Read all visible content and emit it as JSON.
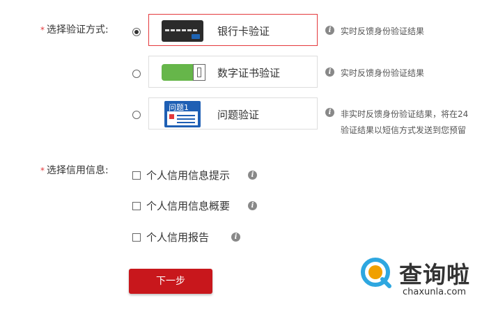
{
  "verify": {
    "label": "选择验证方式:",
    "required_mark": "*",
    "methods": [
      {
        "name": "银行卡验证",
        "icon": "bank-card-icon",
        "selected": true,
        "hint": [
          "实时反馈身份验证结果"
        ]
      },
      {
        "name": "数字证书验证",
        "icon": "usb-key-icon",
        "selected": false,
        "hint": [
          "实时反馈身份验证结果"
        ]
      },
      {
        "name": "问题验证",
        "icon": "questionnaire-icon",
        "icon_text": "问题1",
        "selected": false,
        "hint": [
          "非实时反馈身份验证结果，将在24",
          "验证结果以短信方式发送到您预留"
        ]
      }
    ]
  },
  "credit": {
    "label": "选择信用信息:",
    "required_mark": "*",
    "options": [
      {
        "label": "个人信用信息提示",
        "checked": false
      },
      {
        "label": "个人信用信息概要",
        "checked": false
      },
      {
        "label": "个人信用报告",
        "checked": false
      }
    ]
  },
  "next_button": "下一步",
  "watermark": {
    "brand": "查询啦",
    "url": "chaxunla.com"
  },
  "colors": {
    "accent": "#c8171c",
    "required": "#e4393c",
    "usb_green": "#66b64a",
    "card_blue": "#1e5fb4"
  }
}
